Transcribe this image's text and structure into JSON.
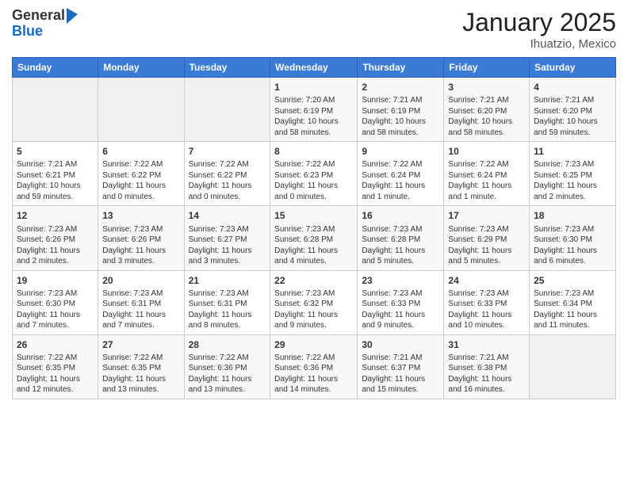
{
  "logo": {
    "general": "General",
    "blue": "Blue"
  },
  "title": "January 2025",
  "location": "Ihuatzio, Mexico",
  "days_header": [
    "Sunday",
    "Monday",
    "Tuesday",
    "Wednesday",
    "Thursday",
    "Friday",
    "Saturday"
  ],
  "weeks": [
    [
      {
        "day": "",
        "info": ""
      },
      {
        "day": "",
        "info": ""
      },
      {
        "day": "",
        "info": ""
      },
      {
        "day": "1",
        "info": "Sunrise: 7:20 AM\nSunset: 6:19 PM\nDaylight: 10 hours\nand 58 minutes."
      },
      {
        "day": "2",
        "info": "Sunrise: 7:21 AM\nSunset: 6:19 PM\nDaylight: 10 hours\nand 58 minutes."
      },
      {
        "day": "3",
        "info": "Sunrise: 7:21 AM\nSunset: 6:20 PM\nDaylight: 10 hours\nand 58 minutes."
      },
      {
        "day": "4",
        "info": "Sunrise: 7:21 AM\nSunset: 6:20 PM\nDaylight: 10 hours\nand 59 minutes."
      }
    ],
    [
      {
        "day": "5",
        "info": "Sunrise: 7:21 AM\nSunset: 6:21 PM\nDaylight: 10 hours\nand 59 minutes."
      },
      {
        "day": "6",
        "info": "Sunrise: 7:22 AM\nSunset: 6:22 PM\nDaylight: 11 hours\nand 0 minutes."
      },
      {
        "day": "7",
        "info": "Sunrise: 7:22 AM\nSunset: 6:22 PM\nDaylight: 11 hours\nand 0 minutes."
      },
      {
        "day": "8",
        "info": "Sunrise: 7:22 AM\nSunset: 6:23 PM\nDaylight: 11 hours\nand 0 minutes."
      },
      {
        "day": "9",
        "info": "Sunrise: 7:22 AM\nSunset: 6:24 PM\nDaylight: 11 hours\nand 1 minute."
      },
      {
        "day": "10",
        "info": "Sunrise: 7:22 AM\nSunset: 6:24 PM\nDaylight: 11 hours\nand 1 minute."
      },
      {
        "day": "11",
        "info": "Sunrise: 7:23 AM\nSunset: 6:25 PM\nDaylight: 11 hours\nand 2 minutes."
      }
    ],
    [
      {
        "day": "12",
        "info": "Sunrise: 7:23 AM\nSunset: 6:26 PM\nDaylight: 11 hours\nand 2 minutes."
      },
      {
        "day": "13",
        "info": "Sunrise: 7:23 AM\nSunset: 6:26 PM\nDaylight: 11 hours\nand 3 minutes."
      },
      {
        "day": "14",
        "info": "Sunrise: 7:23 AM\nSunset: 6:27 PM\nDaylight: 11 hours\nand 3 minutes."
      },
      {
        "day": "15",
        "info": "Sunrise: 7:23 AM\nSunset: 6:28 PM\nDaylight: 11 hours\nand 4 minutes."
      },
      {
        "day": "16",
        "info": "Sunrise: 7:23 AM\nSunset: 6:28 PM\nDaylight: 11 hours\nand 5 minutes."
      },
      {
        "day": "17",
        "info": "Sunrise: 7:23 AM\nSunset: 6:29 PM\nDaylight: 11 hours\nand 5 minutes."
      },
      {
        "day": "18",
        "info": "Sunrise: 7:23 AM\nSunset: 6:30 PM\nDaylight: 11 hours\nand 6 minutes."
      }
    ],
    [
      {
        "day": "19",
        "info": "Sunrise: 7:23 AM\nSunset: 6:30 PM\nDaylight: 11 hours\nand 7 minutes."
      },
      {
        "day": "20",
        "info": "Sunrise: 7:23 AM\nSunset: 6:31 PM\nDaylight: 11 hours\nand 7 minutes."
      },
      {
        "day": "21",
        "info": "Sunrise: 7:23 AM\nSunset: 6:31 PM\nDaylight: 11 hours\nand 8 minutes."
      },
      {
        "day": "22",
        "info": "Sunrise: 7:23 AM\nSunset: 6:32 PM\nDaylight: 11 hours\nand 9 minutes."
      },
      {
        "day": "23",
        "info": "Sunrise: 7:23 AM\nSunset: 6:33 PM\nDaylight: 11 hours\nand 9 minutes."
      },
      {
        "day": "24",
        "info": "Sunrise: 7:23 AM\nSunset: 6:33 PM\nDaylight: 11 hours\nand 10 minutes."
      },
      {
        "day": "25",
        "info": "Sunrise: 7:23 AM\nSunset: 6:34 PM\nDaylight: 11 hours\nand 11 minutes."
      }
    ],
    [
      {
        "day": "26",
        "info": "Sunrise: 7:22 AM\nSunset: 6:35 PM\nDaylight: 11 hours\nand 12 minutes."
      },
      {
        "day": "27",
        "info": "Sunrise: 7:22 AM\nSunset: 6:35 PM\nDaylight: 11 hours\nand 13 minutes."
      },
      {
        "day": "28",
        "info": "Sunrise: 7:22 AM\nSunset: 6:36 PM\nDaylight: 11 hours\nand 13 minutes."
      },
      {
        "day": "29",
        "info": "Sunrise: 7:22 AM\nSunset: 6:36 PM\nDaylight: 11 hours\nand 14 minutes."
      },
      {
        "day": "30",
        "info": "Sunrise: 7:21 AM\nSunset: 6:37 PM\nDaylight: 11 hours\nand 15 minutes."
      },
      {
        "day": "31",
        "info": "Sunrise: 7:21 AM\nSunset: 6:38 PM\nDaylight: 11 hours\nand 16 minutes."
      },
      {
        "day": "",
        "info": ""
      }
    ]
  ]
}
